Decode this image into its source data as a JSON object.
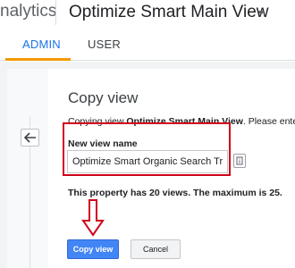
{
  "header": {
    "brand_text": "nalytics",
    "view_name": "Optimize Smart Main View"
  },
  "tabs": [
    {
      "label": "ADMIN",
      "active": true
    },
    {
      "label": "USER",
      "active": false
    }
  ],
  "dialog": {
    "title": "Copy view",
    "copying_prefix": "Copying view ",
    "copying_view": "Optimize Smart Main View",
    "copying_suffix": ". Please enter a",
    "field_label": "New view name",
    "field_value": "Optimize Smart Organic Search Traffic",
    "limit_note": "This property has 20 views. The maximum is 25.",
    "copy_button": "Copy view",
    "cancel_button": "Cancel"
  },
  "colors": {
    "accent": "#1a73e8",
    "tab_underline": "#f29900",
    "primary_button": "#4285f4",
    "annotation_red": "#d0021b"
  },
  "icons": [
    "back-arrow-icon",
    "dropdown-caret-icon",
    "info-icon",
    "annotation-arrow"
  ]
}
